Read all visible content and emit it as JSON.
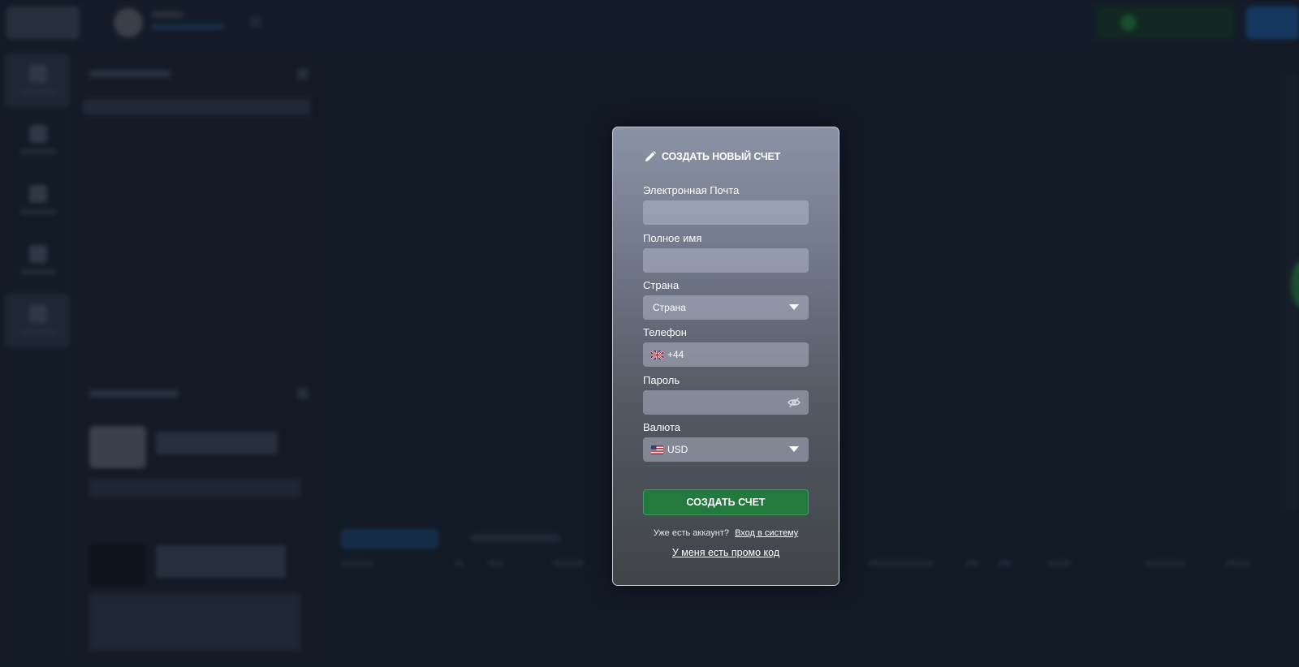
{
  "modal": {
    "title": "СОЗДАТЬ НОВЫЙ СЧЕТ",
    "fields": {
      "email": {
        "label": "Электронная Почта",
        "value": ""
      },
      "full_name": {
        "label": "Полное имя",
        "value": ""
      },
      "country": {
        "label": "Страна",
        "selected": "Страна"
      },
      "phone": {
        "label": "Телефон",
        "prefix": "+44"
      },
      "password": {
        "label": "Пароль",
        "value": ""
      },
      "currency": {
        "label": "Валюта",
        "selected": "USD"
      }
    },
    "submit_label": "СОЗДАТЬ СЧЕТ",
    "login_prompt": "Уже есть аккаунт?",
    "login_link": "Вход в систему",
    "promo_link": "У меня есть промо код"
  },
  "icons": {
    "pencil": "pencil-icon",
    "caret": "caret-down-icon",
    "uk_flag": "uk-flag-icon",
    "us_flag": "us-flag-icon",
    "eye_off": "eye-off-icon"
  },
  "colors": {
    "submit": "#237a3e",
    "background": "#121a26"
  }
}
